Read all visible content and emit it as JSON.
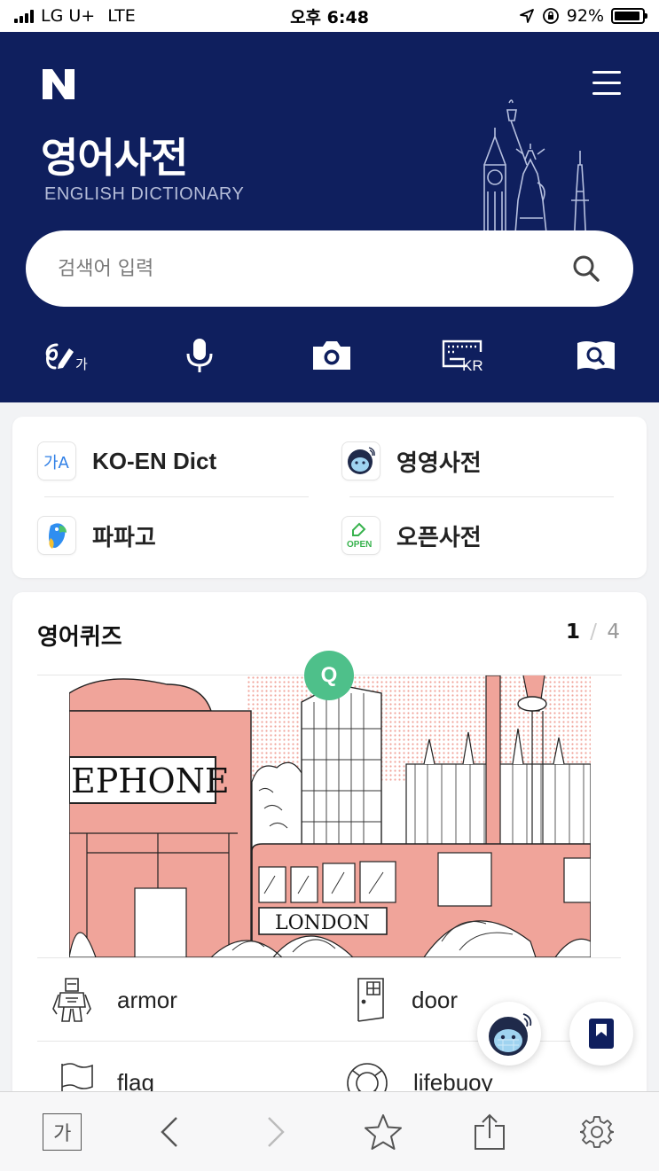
{
  "status_bar": {
    "carrier": "LG U+",
    "network": "LTE",
    "time": "오후 6:48",
    "battery": "92%",
    "battery_level": 0.92
  },
  "header": {
    "logo": "N",
    "title": "영어사전",
    "subtitle": "ENGLISH DICTIONARY",
    "search_placeholder": "검색어 입력",
    "tools": [
      "handwriting-icon",
      "microphone-icon",
      "camera-icon",
      "keyboard-kr-icon",
      "book-search-icon"
    ],
    "handwriting_char": "가",
    "keyboard_label": "KR"
  },
  "dict_links": [
    {
      "label": "KO-EN Dict",
      "icon": "ko-en-icon",
      "icon_text": "가A"
    },
    {
      "label": "영영사전",
      "icon": "mascot-icon"
    },
    {
      "label": "파파고",
      "icon": "papago-icon"
    },
    {
      "label": "오픈사전",
      "icon": "open-dict-icon",
      "icon_text": "OPEN"
    }
  ],
  "quiz": {
    "title": "영어퀴즈",
    "page_current": "1",
    "page_total": "4",
    "badge": "Q",
    "image_text_phone": "EPHONE",
    "image_text_bus": "LONDON",
    "words": [
      {
        "label": "armor",
        "icon": "armor-icon"
      },
      {
        "label": "door",
        "icon": "door-icon"
      },
      {
        "label": "flag",
        "icon": "flag-icon"
      },
      {
        "label": "lifebuoy",
        "icon": "lifebuoy-icon"
      }
    ]
  },
  "bottom_bar": {
    "text_size_label": "가",
    "items": [
      "text-size-button",
      "back-button",
      "forward-button",
      "favorite-button",
      "share-button",
      "settings-button"
    ]
  },
  "colors": {
    "header_bg": "#0f1f5e",
    "quiz_badge": "#4ec08a",
    "illustration_pink": "#f0a49a"
  }
}
